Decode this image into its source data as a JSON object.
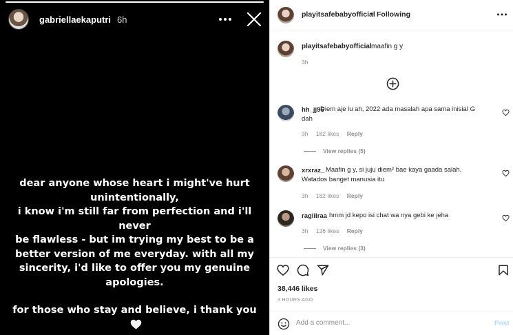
{
  "story": {
    "progress": 1.0,
    "username": "gabriellaekaputri",
    "time": "6h",
    "lines": [
      "dear anyone whose heart i might've hurt\nunintentionally,\ni know i'm still far from perfection and i'll never\nbe flawless - but im trying my best to be a\nbetter version of me everyday. with all my\nsincerity, i'd like to offer you my genuine\napologies."
    ],
    "closing": "for those who stay and believe, i thank you",
    "icons": {
      "more": "more-icon",
      "close": "close-icon",
      "heart": "white-heart-emoji"
    }
  },
  "post": {
    "header": {
      "username": "playitsafebabyofficial",
      "separator": "•",
      "follow_status": "Following",
      "more_icon": "more-icon"
    },
    "caption": {
      "username": "playitsafebabyofficial",
      "text": "maafin g y",
      "time": "3h"
    },
    "load_more_icon": "plus-circle-icon",
    "comments": [
      {
        "username": "hh_jj96",
        "text": "Diem aje lu ah, 2022 ada masalah apa sama inisial G dah",
        "time": "3h",
        "likes": "182 likes",
        "reply": "Reply",
        "view_replies": "View replies (5)"
      },
      {
        "username": "xrxraz_",
        "text": "Maafin g y, si juju diem² bae kaya gaada salah. Watados banget manusia itu",
        "time": "3h",
        "likes": "182 likes",
        "reply": "Reply",
        "view_replies": ""
      },
      {
        "username": "ragiilraa",
        "text": "hmm jd kepo isi chat wa nya gebi ke jeha",
        "time": "3h",
        "likes": "126 likes",
        "reply": "Reply",
        "view_replies": "View replies (3)"
      }
    ],
    "actions": [
      "heart-icon",
      "comment-icon",
      "share-icon",
      "bookmark-icon"
    ],
    "likes": "38,446 likes",
    "posted": "3 HOURS AGO",
    "add_comment": {
      "placeholder": "Add a comment...",
      "post_label": "Post"
    }
  }
}
